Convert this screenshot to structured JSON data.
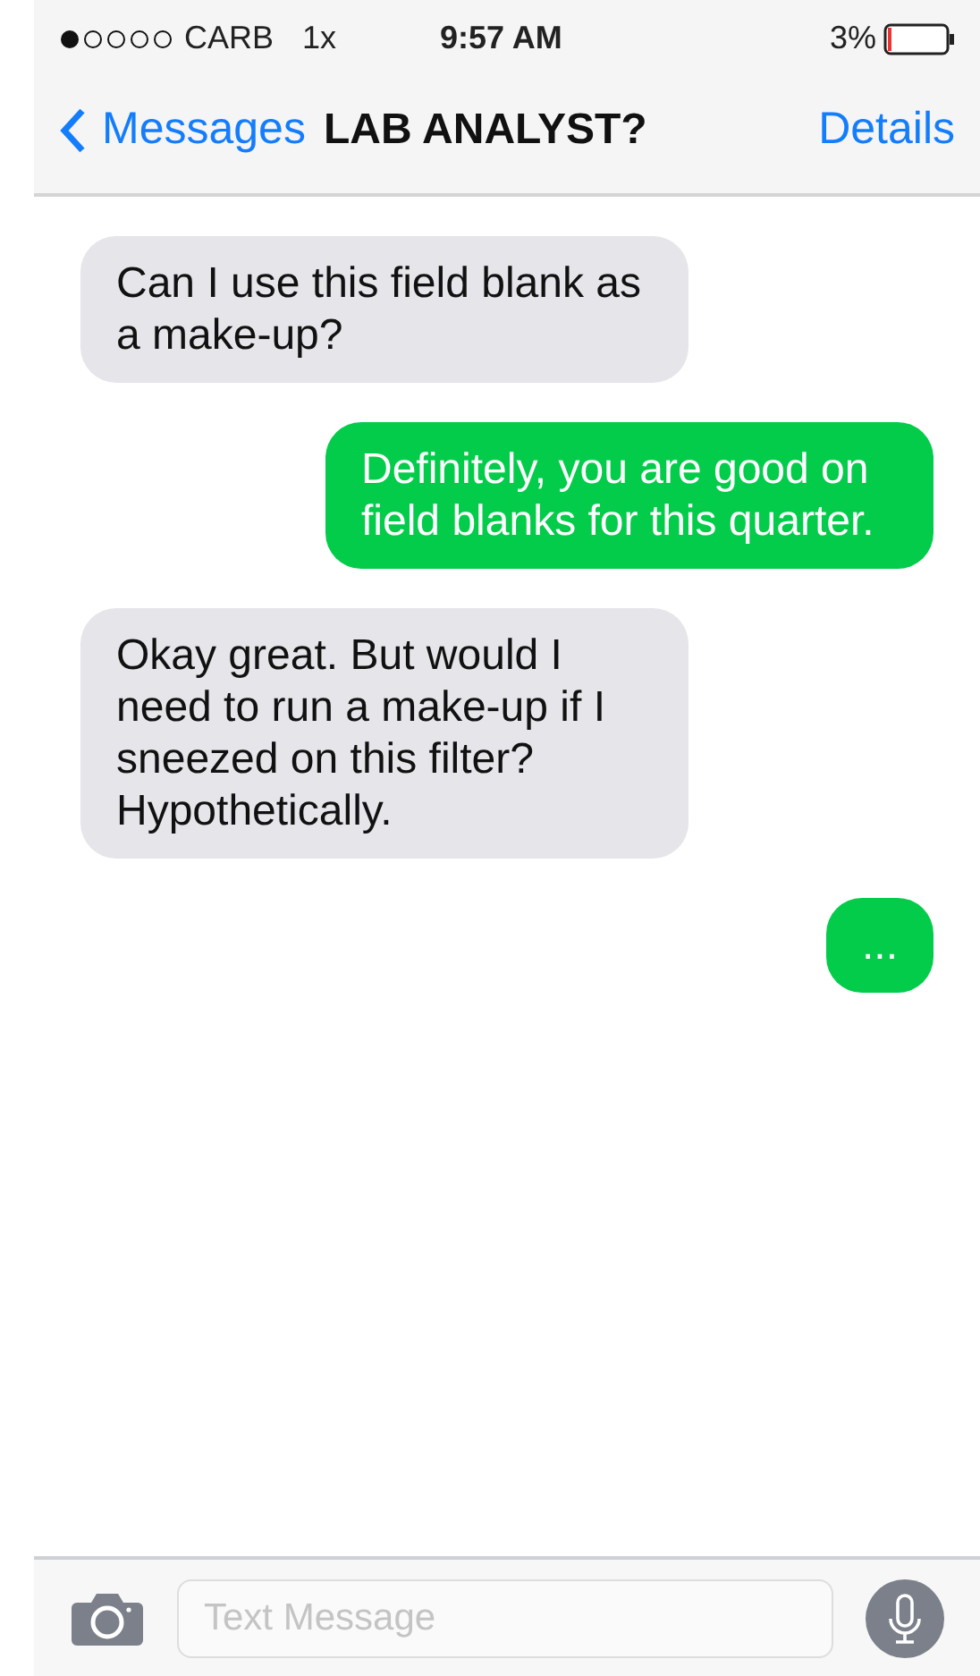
{
  "status_bar": {
    "carrier": "CARB",
    "network": "1x",
    "time": "9:57 AM",
    "battery": "3%"
  },
  "nav": {
    "back": "Messages",
    "title": "LAB ANALYST?",
    "action": "Details"
  },
  "messages": [
    {
      "kind": "received",
      "text": "Can I use this field blank as a make-up?"
    },
    {
      "kind": "sent",
      "text": "Definitely, you are good on field blanks for this quarter."
    },
    {
      "kind": "received",
      "text": "Okay great. But would I need to run a make-up if I sneezed on this filter? Hypothetically."
    },
    {
      "kind": "sent",
      "text": "..."
    }
  ],
  "composer": {
    "placeholder": "Text Message"
  }
}
